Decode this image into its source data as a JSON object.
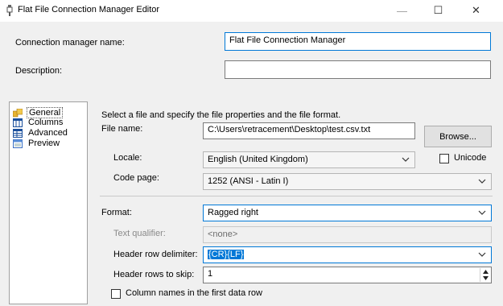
{
  "window": {
    "title": "Flat File Connection Manager Editor",
    "minimize_glyph": "—",
    "maximize_glyph": "☐",
    "close_glyph": "✕"
  },
  "form": {
    "connection_manager_name_label": "Connection manager name:",
    "connection_manager_name_value": "Flat File Connection Manager",
    "description_label": "Description:",
    "description_value": ""
  },
  "nav": {
    "items": [
      {
        "label": "General",
        "icon": "general-icon",
        "selected": true
      },
      {
        "label": "Columns",
        "icon": "columns-icon",
        "selected": false
      },
      {
        "label": "Advanced",
        "icon": "advanced-icon",
        "selected": false
      },
      {
        "label": "Preview",
        "icon": "preview-icon",
        "selected": false
      }
    ]
  },
  "general": {
    "instructions": "Select a file and specify the file properties and the file format.",
    "file_name_label": "File name:",
    "file_name_value": "C:\\Users\\retracement\\Desktop\\test.csv.txt",
    "browse_label": "Browse...",
    "locale_label": "Locale:",
    "locale_value": "English (United Kingdom)",
    "unicode_label": "Unicode",
    "unicode_checked": false,
    "code_page_label": "Code page:",
    "code_page_value": "1252  (ANSI - Latin I)",
    "format_label": "Format:",
    "format_value": "Ragged right",
    "text_qualifier_label": "Text qualifier:",
    "text_qualifier_value": "<none>",
    "header_row_delimiter_label": "Header row delimiter:",
    "header_row_delimiter_value": "{CR}{LF}",
    "header_rows_to_skip_label": "Header rows to skip:",
    "header_rows_to_skip_value": "1",
    "column_names_label": "Column names in the first data row",
    "column_names_checked": false
  },
  "colors": {
    "accent": "#0078d7",
    "window_bg": "#f0f0f0"
  }
}
